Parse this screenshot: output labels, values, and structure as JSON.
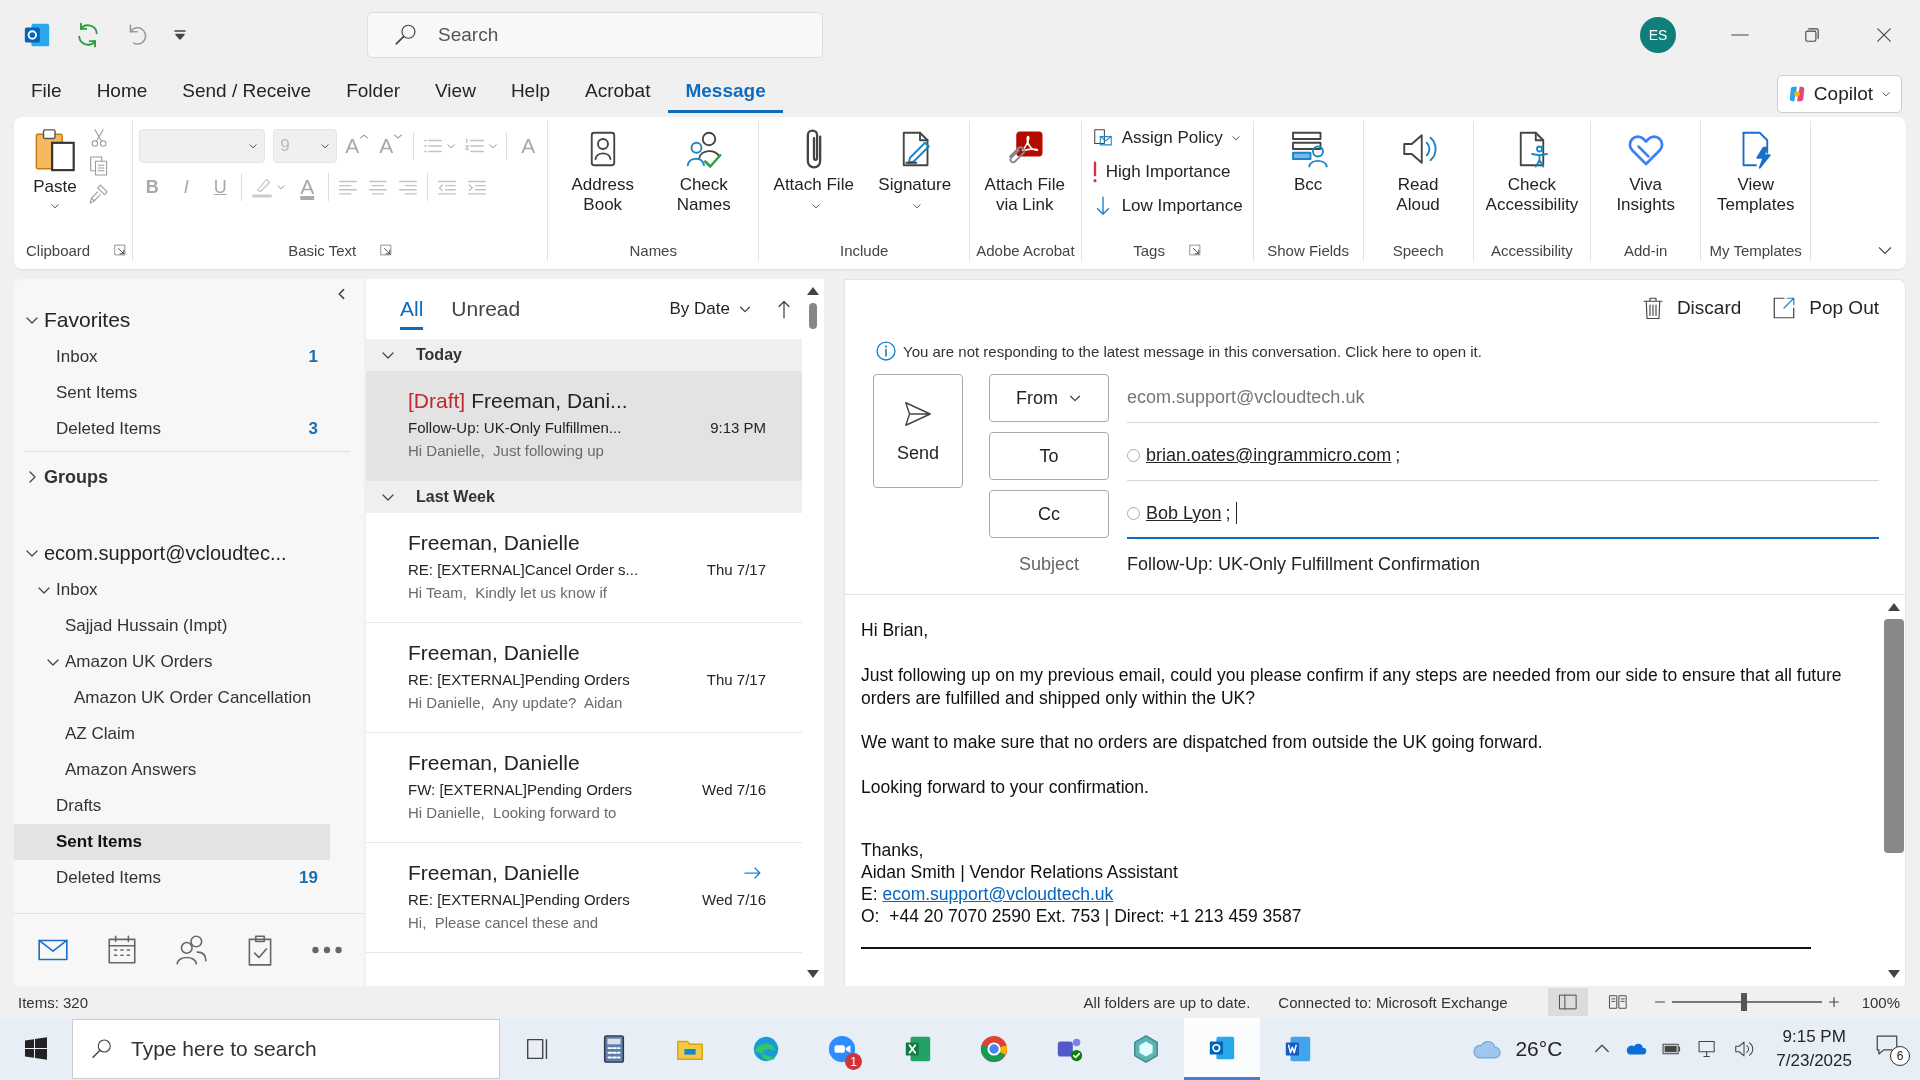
{
  "title_bar": {
    "search_placeholder": "Search",
    "avatar": "ES"
  },
  "menu": [
    {
      "label": "File",
      "selected": false
    },
    {
      "label": "Home",
      "selected": false
    },
    {
      "label": "Send / Receive",
      "selected": false
    },
    {
      "label": "Folder",
      "selected": false
    },
    {
      "label": "View",
      "selected": false
    },
    {
      "label": "Help",
      "selected": false
    },
    {
      "label": "Acrobat",
      "selected": false
    },
    {
      "label": "Message",
      "selected": true
    }
  ],
  "copilot": "Copilot",
  "ribbon": [
    {
      "kind": "clipboard",
      "label": "Clipboard",
      "launcher": true,
      "paste": "Paste"
    },
    {
      "kind": "basic_text",
      "label": "Basic Text",
      "launcher": true,
      "disabled": true,
      "font_size": "9",
      "glyphs": {
        "grow": "A",
        "shrink": "A",
        "clear": "A",
        "bold": "B",
        "italic": "I",
        "underline": "U",
        "font_color": "A"
      }
    },
    {
      "kind": "large",
      "label": "Names",
      "launcher": false,
      "buttons": [
        {
          "label": "Address Book",
          "caret": false
        },
        {
          "label": "Check Names",
          "caret": false
        }
      ]
    },
    {
      "kind": "large",
      "label": "Include",
      "launcher": false,
      "buttons": [
        {
          "label": "Attach File",
          "caret": true
        },
        {
          "label": "Signature",
          "caret": true
        }
      ]
    },
    {
      "kind": "large",
      "label": "Adobe Acrobat",
      "launcher": false,
      "buttons": [
        {
          "label": "Attach File via Link",
          "caret": false
        }
      ]
    },
    {
      "kind": "tags",
      "label": "Tags",
      "launcher": true,
      "items": [
        {
          "label": "Assign Policy",
          "caret": true
        },
        {
          "label": "High Importance",
          "caret": false
        },
        {
          "label": "Low Importance",
          "caret": false
        }
      ]
    },
    {
      "kind": "large",
      "label": "Show Fields",
      "launcher": false,
      "buttons": [
        {
          "label": "Bcc",
          "caret": false
        }
      ]
    },
    {
      "kind": "large",
      "label": "Speech",
      "launcher": false,
      "buttons": [
        {
          "label": "Read Aloud",
          "caret": false
        }
      ]
    },
    {
      "kind": "large",
      "label": "Accessibility",
      "launcher": false,
      "buttons": [
        {
          "label": "Check Accessibility",
          "caret": false
        }
      ]
    },
    {
      "kind": "large",
      "label": "Add-in",
      "launcher": false,
      "buttons": [
        {
          "label": "Viva Insights",
          "caret": false
        }
      ]
    },
    {
      "kind": "large",
      "label": "My Templates",
      "launcher": false,
      "buttons": [
        {
          "label": "View Templates",
          "caret": false
        }
      ]
    }
  ],
  "nav": {
    "favorites": {
      "label": "Favorites",
      "expanded": true,
      "items": [
        {
          "label": "Inbox",
          "count": "1",
          "selected": false
        },
        {
          "label": "Sent Items",
          "selected": false
        },
        {
          "label": "Deleted Items",
          "count": "3",
          "selected": false
        }
      ]
    },
    "groups": {
      "label": "Groups",
      "expanded": false
    },
    "account": {
      "label": "ecom.support@vcloudtec...",
      "expanded": true,
      "items": [
        {
          "label": "Inbox",
          "selected": false,
          "expanded": true,
          "children": [
            {
              "label": "Sajjad Hussain (Impt)",
              "selected": false
            },
            {
              "label": "Amazon UK Orders",
              "selected": false,
              "expanded": true,
              "children": [
                {
                  "label": "Amazon UK Order Cancellation",
                  "selected": false
                }
              ]
            },
            {
              "label": "AZ Claim",
              "selected": false
            },
            {
              "label": "Amazon Answers",
              "selected": false
            }
          ]
        },
        {
          "label": "Drafts",
          "selected": false
        },
        {
          "label": "Sent Items",
          "selected": true
        },
        {
          "label": "Deleted Items",
          "count": "19",
          "selected": false
        }
      ]
    },
    "modules": [
      {
        "selected": true
      },
      {
        "selected": false
      },
      {
        "selected": false
      },
      {
        "selected": false
      },
      {
        "selected": false
      }
    ]
  },
  "message_list": {
    "filters": [
      {
        "label": "All",
        "selected": true
      },
      {
        "label": "Unread",
        "selected": false
      }
    ],
    "sort": "By Date",
    "groups": [
      {
        "label": "Today",
        "expanded": true,
        "messages": [
          {
            "draft_tag": "[Draft]",
            "sender": "Freeman, Dani...",
            "subject": "Follow-Up: UK-Only Fulfillmen...",
            "preview": "Hi Danielle,  Just following up",
            "time": "9:13 PM",
            "selected": true,
            "forwarded": false
          }
        ]
      },
      {
        "label": "Last Week",
        "expanded": true,
        "messages": [
          {
            "sender": "Freeman, Danielle",
            "subject": "RE: [EXTERNAL]Cancel Order s...",
            "preview": "Hi Team,  Kindly let us know if",
            "time": "Thu 7/17",
            "selected": false,
            "forwarded": false
          },
          {
            "sender": "Freeman, Danielle",
            "subject": "RE: [EXTERNAL]Pending Orders",
            "preview": "Hi Danielle,  Any update?  Aidan",
            "time": "Thu 7/17",
            "selected": false,
            "forwarded": false
          },
          {
            "sender": "Freeman, Danielle",
            "subject": "FW: [EXTERNAL]Pending Orders",
            "preview": "Hi Danielle,  Looking forward to",
            "time": "Wed 7/16",
            "selected": false,
            "forwarded": false
          },
          {
            "sender": "Freeman, Danielle",
            "subject": "RE: [EXTERNAL]Pending Orders",
            "preview": "Hi,  Please cancel these and",
            "time": "Wed 7/16",
            "selected": false,
            "forwarded": true
          }
        ]
      }
    ]
  },
  "compose": {
    "discard": "Discard",
    "pop_out": "Pop Out",
    "info": "You are not responding to the latest message in this conversation. Click here to open it.",
    "send": "Send",
    "from_button": "From",
    "from": "ecom.support@vcloudtech.uk",
    "to_button": "To",
    "to": [
      "brian.oates@ingrammicro.com;"
    ],
    "cc_button": "Cc",
    "cc": [
      "Bob Lyon;"
    ],
    "subject_label": "Subject",
    "subject": "Follow-Up: UK-Only Fulfillment Confirmation",
    "body": [
      "Hi Brian,",
      "Just following up on my previous email, could you please confirm if any steps are needed from our side to ensure that all future orders are fulfilled and shipped only within the UK?",
      "We want to make sure that no orders are dispatched from outside the UK going forward.",
      "Looking forward to your confirmation."
    ],
    "signoff": "Thanks,",
    "signature": {
      "name_line": "Aidan Smith | Vendor Relations Assistant",
      "email_label": "E:",
      "email": "ecom.support@vcloudtech.uk",
      "phone_line": "O:  +44 20 7070 2590 Ext. 753 | Direct: +1 213 459 3587"
    }
  },
  "status_bar": {
    "items": "Items: 320",
    "sync": "All folders are up to date.",
    "connection": "Connected to: Microsoft Exchange",
    "views": [
      {
        "selected": true
      },
      {
        "selected": false
      }
    ],
    "zoom": {
      "level": 0.48
    },
    "zoom_label": "100%"
  },
  "taskbar": {
    "search_placeholder": "Type here to search",
    "apps": [
      {
        "active": false
      },
      {
        "active": false
      },
      {
        "active": false
      },
      {
        "active": false
      },
      {
        "active": false,
        "badge": "1"
      },
      {
        "active": false
      },
      {
        "active": false
      },
      {
        "active": false
      },
      {
        "active": false
      },
      {
        "active": true
      },
      {
        "active": false
      }
    ],
    "weather": "26°C",
    "time": "9:15 PM",
    "date": "7/23/2025",
    "notifications": "6"
  }
}
